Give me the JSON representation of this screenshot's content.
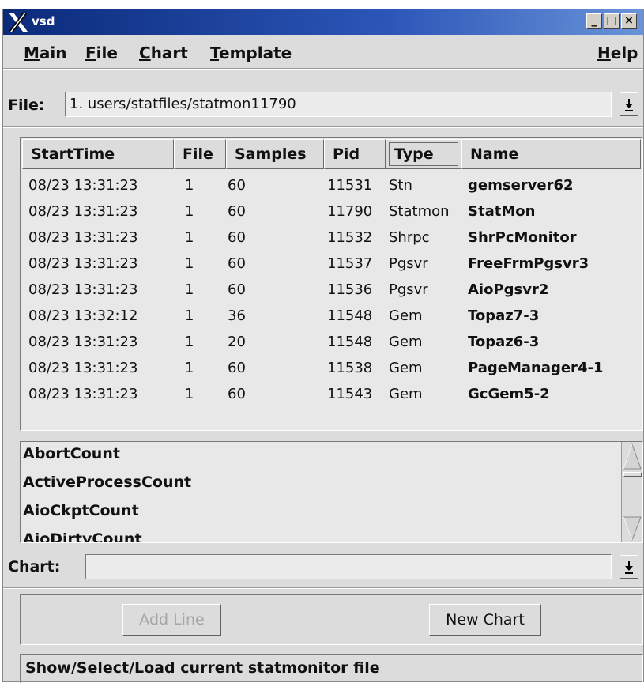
{
  "window": {
    "title": "vsd"
  },
  "titlebar_buttons": {
    "minimize": "_",
    "maximize": "□",
    "close": "×"
  },
  "menubar": {
    "items": [
      {
        "label": "Main",
        "ul": "M",
        "rest": "ain"
      },
      {
        "label": "File",
        "ul": "F",
        "rest": "ile"
      },
      {
        "label": "Chart",
        "ul": "C",
        "rest": "hart"
      },
      {
        "label": "Template",
        "ul": "T",
        "rest": "emplate"
      }
    ],
    "help": {
      "ul": "H",
      "rest": "elp"
    }
  },
  "file_row": {
    "label": "File:",
    "value": "1. users/statfiles/statmon11790"
  },
  "table": {
    "columns": [
      "StartTime",
      "File",
      "Samples",
      "Pid",
      "Type",
      "Name"
    ],
    "rows": [
      [
        "08/23 13:31:23",
        "1",
        "60",
        "11531",
        "Stn",
        "gemserver62"
      ],
      [
        "08/23 13:31:23",
        "1",
        "60",
        "11790",
        "Statmon",
        "StatMon"
      ],
      [
        "08/23 13:31:23",
        "1",
        "60",
        "11532",
        "Shrpc",
        "ShrPcMonitor"
      ],
      [
        "08/23 13:31:23",
        "1",
        "60",
        "11537",
        "Pgsvr",
        "FreeFrmPgsvr3"
      ],
      [
        "08/23 13:31:23",
        "1",
        "60",
        "11536",
        "Pgsvr",
        "AioPgsvr2"
      ],
      [
        "08/23 13:32:12",
        "1",
        "36",
        "11548",
        "Gem",
        "Topaz7-3"
      ],
      [
        "08/23 13:31:23",
        "1",
        "20",
        "11548",
        "Gem",
        "Topaz6-3"
      ],
      [
        "08/23 13:31:23",
        "1",
        "60",
        "11538",
        "Gem",
        "PageManager4-1"
      ],
      [
        "08/23 13:31:23",
        "1",
        "60",
        "11543",
        "Gem",
        "GcGem5-2"
      ]
    ]
  },
  "stat_list": {
    "items": [
      "AbortCount",
      "ActiveProcessCount",
      "AioCkptCount",
      "AioDirtyCount"
    ]
  },
  "chart_row": {
    "label": "Chart:",
    "value": ""
  },
  "buttons": {
    "add_line": "Add Line",
    "new_chart": "New Chart"
  },
  "status": {
    "text": "Show/Select/Load current statmonitor file"
  },
  "icons": {
    "x-logo": "x-logo-icon",
    "dropdown": "down-arrow-icon"
  }
}
